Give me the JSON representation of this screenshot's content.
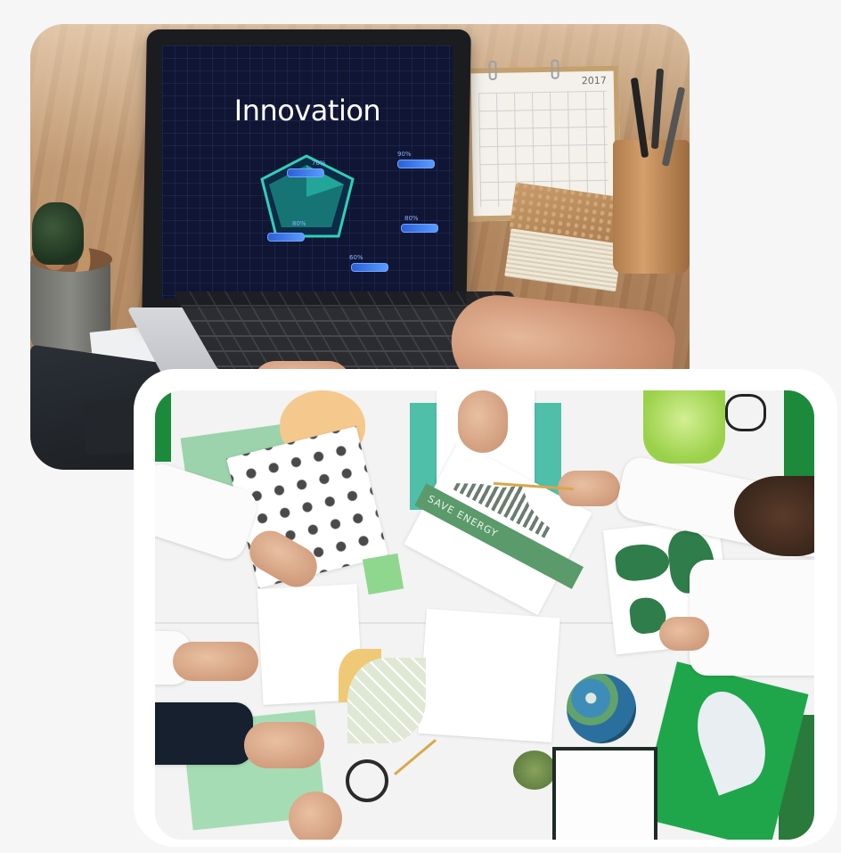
{
  "top_photo": {
    "screen_title": "Innovation",
    "radar_stats": [
      "70%",
      "90%",
      "80%",
      "80%",
      "60%"
    ],
    "calendar_year": "2017"
  },
  "bottom_photo": {
    "energy_label": "SAVE ENERGY"
  },
  "colors": {
    "background": "#f6f6f7",
    "frame": "#ffffff",
    "screen": "#0f1533",
    "accent_green": "#1fa64a",
    "radar_teal": "#2fd0b8"
  }
}
